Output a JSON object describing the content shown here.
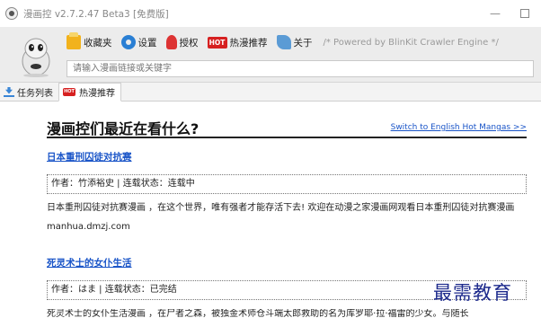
{
  "window": {
    "title": "漫画控 v2.7.2.47 Beta3 [免费版]",
    "minimize_glyph": "—"
  },
  "toolbar": {
    "favorites_label": "收藏夹",
    "settings_label": "设置",
    "authorize_label": "授权",
    "hot_badge": "HOT",
    "hot_label": "热漫推荐",
    "about_label": "关于",
    "powered_note": "/* Powered by BlinKit Crawler Engine */"
  },
  "search": {
    "placeholder": "请输入漫画链接或关键字"
  },
  "tabs": [
    {
      "label": "任务列表",
      "icon": "download-icon"
    },
    {
      "label": "热漫推荐",
      "icon": "hot-icon",
      "badge": "HOT"
    }
  ],
  "main": {
    "heading": "漫画控们最近在看什么?",
    "switch_link": "Switch to English Hot Mangas >>",
    "mangas": [
      {
        "title": "日本重刑囚徒对抗赛",
        "meta": "作者：竹添裕史 | 连载状态：连载中",
        "description": "日本重刑囚徒对抗赛漫画 ，在这个世界，唯有强者才能存活下去! 欢迎在动漫之家漫画网观看日本重刑囚徒对抗赛漫画",
        "source": "manhua.dmzj.com"
      },
      {
        "title": "死灵术士的女仆生活",
        "meta": "作者：はま | 连载状态：已完结",
        "description": "死灵术士的女仆生活漫画 ，在尸者之森，被独金术师仓斗端太郎救助的名为库罗耶·拉·福雷的少女。与随长"
      }
    ]
  },
  "watermark": "最需教育",
  "colors": {
    "link": "#1a55c8",
    "hot_red": "#d62020",
    "toolbar_bg": "#ececec",
    "watermark": "#1d2a8c"
  }
}
